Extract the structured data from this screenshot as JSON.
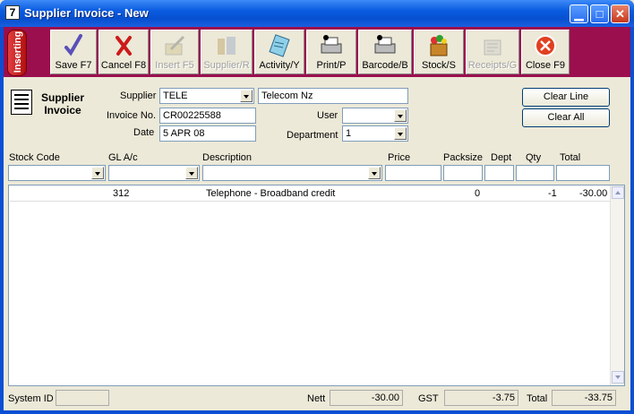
{
  "window": {
    "title": "Supplier Invoice - New",
    "app_icon": "7"
  },
  "toolbar": {
    "mode": "Inserting",
    "buttons": [
      {
        "label": "Save F7",
        "icon": "checkmark-icon",
        "enabled": true
      },
      {
        "label": "Cancel F8",
        "icon": "red-x-icon",
        "enabled": true
      },
      {
        "label": "Insert F5",
        "icon": "insert-pen-icon",
        "enabled": false
      },
      {
        "label": "Supplier/R",
        "icon": "supplier-icon",
        "enabled": false
      },
      {
        "label": "Activity/Y",
        "icon": "activity-scroll-icon",
        "enabled": true
      },
      {
        "label": "Print/P",
        "icon": "printer-icon",
        "enabled": true
      },
      {
        "label": "Barcode/B",
        "icon": "barcode-printer-icon",
        "enabled": true
      },
      {
        "label": "Stock/S",
        "icon": "stock-box-icon",
        "enabled": true
      },
      {
        "label": "Receipts/G",
        "icon": "receipts-icon",
        "enabled": false
      },
      {
        "label": "Close F9",
        "icon": "close-circle-icon",
        "enabled": true
      }
    ]
  },
  "header": {
    "title_line1": "Supplier",
    "title_line2": "Invoice"
  },
  "form": {
    "supplier_label": "Supplier",
    "supplier_code": "TELE",
    "supplier_name": "Telecom Nz",
    "invoice_no_label": "Invoice No.",
    "invoice_no": "CR00225588",
    "date_label": "Date",
    "date": "5 APR 08",
    "user_label": "User",
    "user": "",
    "department_label": "Department",
    "department": "1"
  },
  "actions": {
    "clear_line": "Clear Line",
    "clear_all": "Clear All"
  },
  "columns": {
    "stock_code": "Stock Code",
    "gl_ac": "GL A/c",
    "description": "Description",
    "price": "Price",
    "packsize": "Packsize",
    "dept": "Dept",
    "qty": "Qty",
    "total": "Total"
  },
  "rows": [
    {
      "stock_code": "",
      "gl_ac": "312",
      "description": "Telephone - Broadband credit",
      "price": "",
      "packsize": "0",
      "dept": "",
      "qty": "-1",
      "total": "-30.00"
    }
  ],
  "footer": {
    "system_id_label": "System ID",
    "system_id": "",
    "nett_label": "Nett",
    "nett": "-30.00",
    "gst_label": "GST",
    "gst": "-3.75",
    "total_label": "Total",
    "total": "-33.75"
  },
  "colors": {
    "toolbar_bg": "#9b0f4e",
    "titlebar": "#0a5be0",
    "window_bg": "#ece9d8"
  }
}
